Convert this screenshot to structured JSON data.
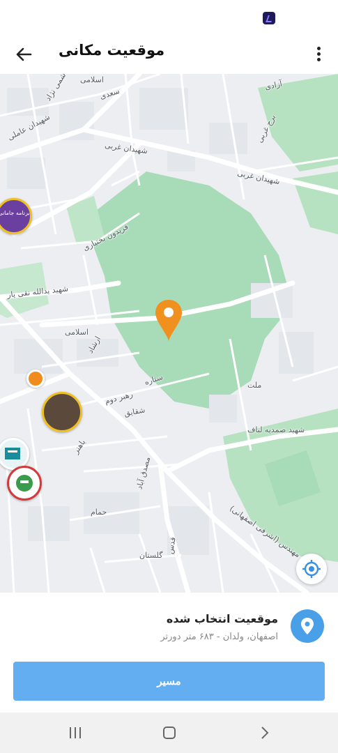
{
  "app_bar": {
    "title": "موقعیت مکانی"
  },
  "map": {
    "labels": {
      "saadi": "سعدی",
      "eslami_top": "اسلامی",
      "hashemi": "هاشمی نژاد",
      "shahidan_ameli": "شهیدان عاملی",
      "shahidan_gharbi_1": "شهیدان غربی",
      "shahidan_gharbi_2": "شهیدان غربی",
      "fereydoun": "فریدون بختیاری",
      "yadollah": "شهید یدالله نقی یار",
      "eslami_mid": "اسلامی",
      "ershad": "ارشاد",
      "mellat": "ملت",
      "samadiyeh": "شهید صمدیه لباف",
      "esfahani": "مهندس (اشرفی اصفهانی)",
      "qods": "قدس",
      "sattareh": "ستاره",
      "rahbar": "رهبر دوم",
      "shaghayegh": "شقایق",
      "bahonar": "باهنر",
      "golestan": "گلستان",
      "hammam": "حمام",
      "dorj": "برج غربی",
      "mosadegh": "مصدق آباد",
      "azadi": "آزادی"
    },
    "poi": {
      "badge_left": "برنامه جامانی"
    }
  },
  "bottom_sheet": {
    "title": "موقعیت انتخاب شده",
    "address": "اصفهان، ولدان - ۶۸۳ متر دورتر",
    "route_label": "مسیر"
  }
}
